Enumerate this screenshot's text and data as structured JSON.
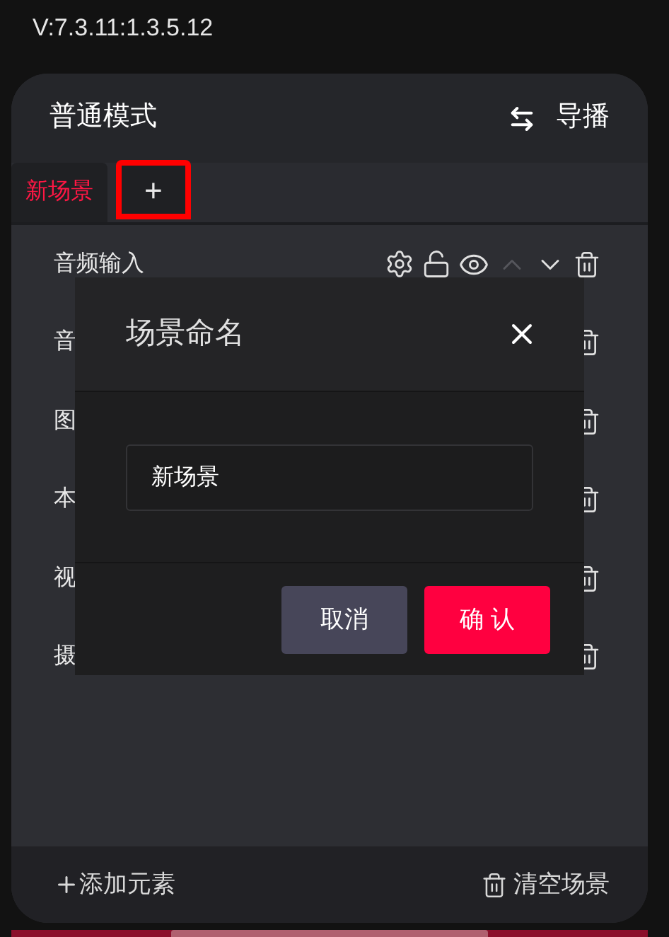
{
  "version": "V:7.3.11:1.3.5.12",
  "header": {
    "title": "普通模式",
    "switch_label": "导播"
  },
  "tabs": [
    {
      "label": "新场景",
      "selected": true,
      "outlined": false
    },
    {
      "label": "+",
      "selected": false,
      "outlined": true
    }
  ],
  "rows": [
    {
      "label": "音频输入",
      "kind": "full",
      "up_disabled": true
    },
    {
      "label": "音",
      "kind": "partial"
    },
    {
      "label": "图",
      "kind": "partial"
    },
    {
      "label": "本",
      "kind": "partial"
    },
    {
      "label": "视",
      "kind": "partial"
    },
    {
      "label": "摄",
      "kind": "partial"
    }
  ],
  "footer": {
    "add_label": "添加元素",
    "clear_label": "清空场景"
  },
  "dialog": {
    "title": "场景命名",
    "value": "新场景",
    "buttons": [
      {
        "label": "取消",
        "kind": "secondary"
      },
      {
        "label": "确 认",
        "kind": "primary"
      }
    ]
  }
}
